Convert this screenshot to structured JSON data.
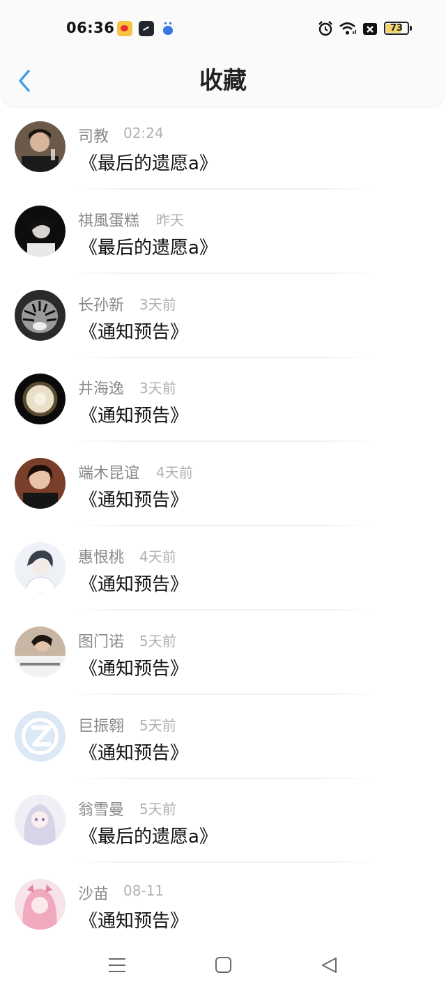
{
  "status_bar": {
    "time": "06:36",
    "apps": [
      "weibo-icon",
      "clock-app-icon",
      "baidu-icon"
    ],
    "icons": [
      "alarm-icon",
      "wifi-icon",
      "sim-off-icon"
    ],
    "battery_level": "73",
    "battery_fraction": 0.73,
    "battery_color": "#f1d46a"
  },
  "nav": {
    "title": "收藏",
    "accent_color": "#3d9fe6"
  },
  "items": [
    {
      "name": "司教",
      "time": "02:24",
      "title": "《最后的遗愿a》"
    },
    {
      "name": "祺風蛋糕",
      "time": "昨天",
      "title": "《最后的遗愿a》"
    },
    {
      "name": "长孙新",
      "time": "3天前",
      "title": "《通知预告》"
    },
    {
      "name": "井海逸",
      "time": "3天前",
      "title": "《通知预告》"
    },
    {
      "name": "端木昆谊",
      "time": "4天前",
      "title": "《通知预告》"
    },
    {
      "name": "惠恨桃",
      "time": "4天前",
      "title": "《通知预告》"
    },
    {
      "name": "图门诺",
      "time": "5天前",
      "title": "《通知预告》"
    },
    {
      "name": "巨振翱",
      "time": "5天前",
      "title": "《通知预告》"
    },
    {
      "name": "翁雪曼",
      "time": "5天前",
      "title": "《最后的遗愿a》"
    },
    {
      "name": "沙苗",
      "time": "08-11",
      "title": "《通知预告》"
    }
  ],
  "bottom_nav": [
    "menu-icon",
    "home-icon",
    "back-triangle-icon"
  ]
}
